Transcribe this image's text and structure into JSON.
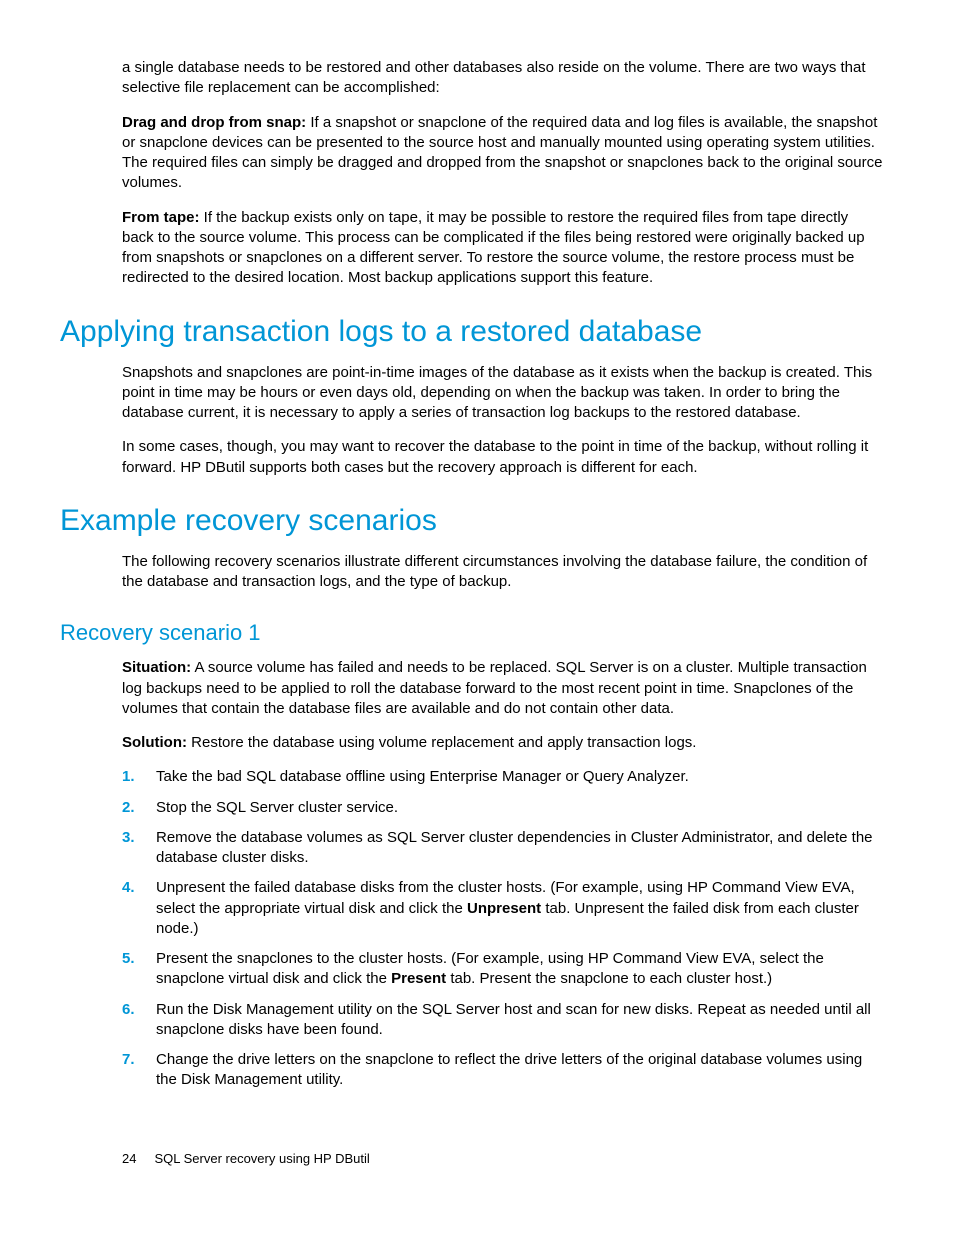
{
  "intro": {
    "p1": "a single database needs to be restored and other databases also reside on the volume. There are two ways that selective file replacement can be accomplished:",
    "p2_lead": "Drag and drop from snap:",
    "p2_body": " If a snapshot or snapclone of the required data and log files is available, the snapshot or snapclone devices can be presented to the source host and manually mounted using operating system utilities. The required files can simply be dragged and dropped from the snapshot or snapclones back to the original source volumes.",
    "p3_lead": "From tape:",
    "p3_body": " If the backup exists only on tape, it may be possible to restore the required files from tape directly back to the source volume. This process can be complicated if the files being restored were originally backed up from snapshots or snapclones on a different server. To restore the source volume, the restore process must be redirected to the desired location. Most backup applications support this feature."
  },
  "section1": {
    "title": "Applying transaction logs to a restored database",
    "p1": "Snapshots and snapclones are point-in-time images of the database as it exists when the backup is created. This point in time may be hours or even days old, depending on when the backup was taken. In order to bring the database current, it is necessary to apply a series of transaction log backups to the restored database.",
    "p2": "In some cases, though, you may want to recover the database to the point in time of the backup, without rolling it forward. HP DButil supports both cases but the recovery approach is different for each."
  },
  "section2": {
    "title": "Example recovery scenarios",
    "p1": "The following recovery scenarios illustrate different circumstances involving the database failure, the condition of the database and transaction logs, and the type of backup."
  },
  "scenario1": {
    "title": "Recovery scenario 1",
    "situation_lead": "Situation:",
    "situation_body": " A source volume has failed and needs to be replaced. SQL Server is on a cluster. Multiple transaction log backups need to be applied to roll the database forward to the most recent point in time. Snapclones of the volumes that contain the database files are available and do not contain other data.",
    "solution_lead": "Solution:",
    "solution_body": " Restore the database using volume replacement and apply transaction logs.",
    "steps": [
      "Take the bad SQL database offline using Enterprise Manager or Query Analyzer.",
      "Stop the SQL Server cluster service.",
      "Remove the database volumes as SQL Server cluster dependencies in Cluster Administrator, and delete the database cluster disks.",
      {
        "pre": "Unpresent the failed database disks from the cluster hosts. (For example, using HP Command View EVA, select the appropriate virtual disk and click the ",
        "bold": "Unpresent",
        "post": " tab. Unpresent the failed disk from each cluster node.)"
      },
      {
        "pre": "Present the snapclones to the cluster hosts. (For example, using HP Command View EVA, select the snapclone virtual disk and click the ",
        "bold": "Present",
        "post": " tab. Present the snapclone to each cluster host.)"
      },
      "Run the Disk Management utility on the SQL Server host and scan for new disks. Repeat as needed until all snapclone disks have been found.",
      "Change the drive letters on the snapclone to reflect the drive letters of the original database volumes using the Disk Management utility."
    ]
  },
  "footer": {
    "page": "24",
    "title": "SQL Server recovery using HP DButil"
  }
}
